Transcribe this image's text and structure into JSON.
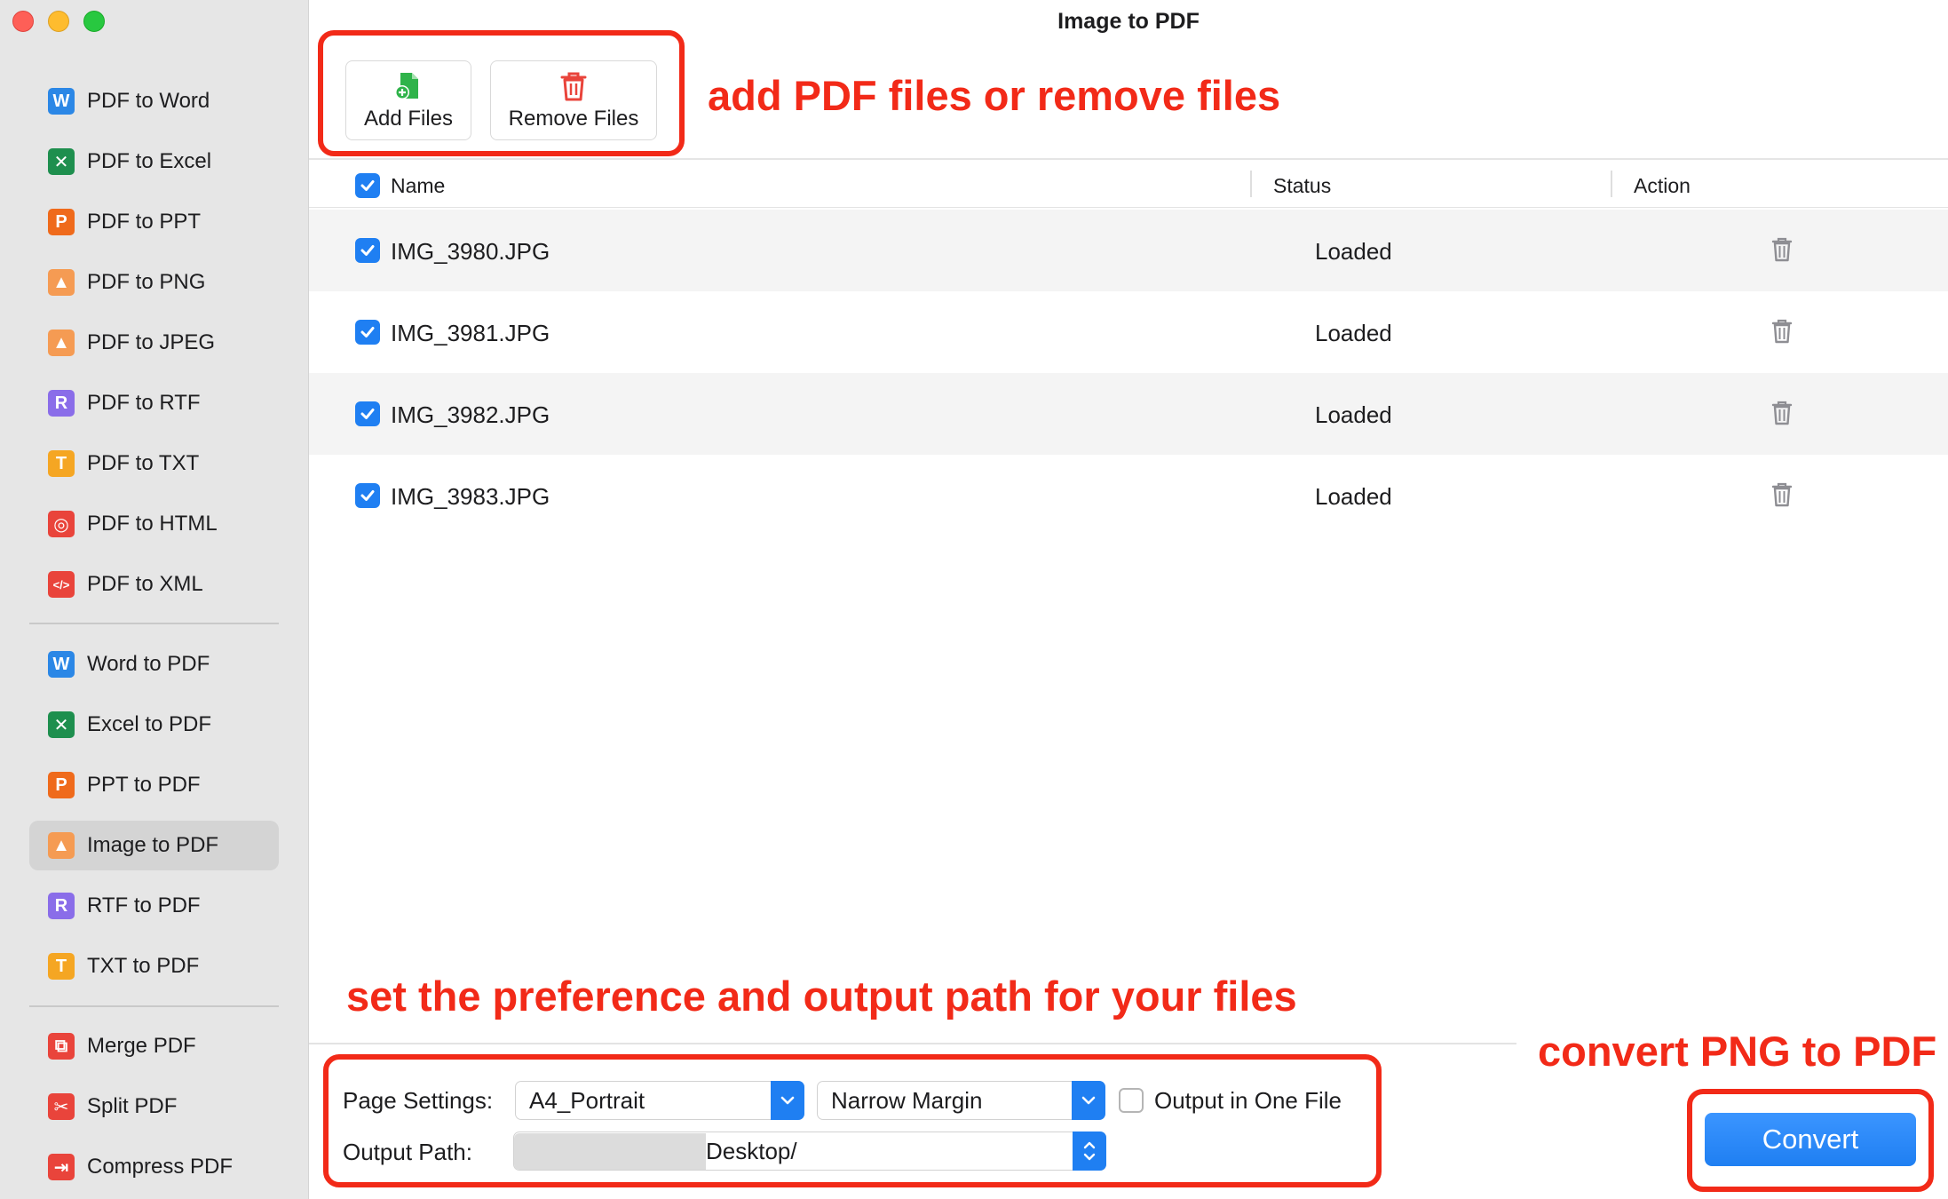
{
  "window": {
    "title": "Image to PDF"
  },
  "sidebar": {
    "items": [
      {
        "label": "PDF to Word",
        "icon": "word-icon",
        "glyph": "W",
        "color": "#2b87e6"
      },
      {
        "label": "PDF to Excel",
        "icon": "excel-icon",
        "glyph": "✕",
        "color": "#1e8f4e"
      },
      {
        "label": "PDF to PPT",
        "icon": "ppt-icon",
        "glyph": "P",
        "color": "#ef6a1b"
      },
      {
        "label": "PDF to PNG",
        "icon": "image-icon",
        "glyph": "▲",
        "color": "#f59b53"
      },
      {
        "label": "PDF to JPEG",
        "icon": "image-icon",
        "glyph": "▲",
        "color": "#f59b53"
      },
      {
        "label": "PDF to RTF",
        "icon": "rtf-icon",
        "glyph": "R",
        "color": "#8a6de9"
      },
      {
        "label": "PDF to TXT",
        "icon": "txt-icon",
        "glyph": "T",
        "color": "#f5a623"
      },
      {
        "label": "PDF to HTML",
        "icon": "globe-icon",
        "glyph": "◎",
        "color": "#e9443b"
      },
      {
        "label": "PDF to XML",
        "icon": "code-icon",
        "glyph": "</>",
        "color": "#e9443b"
      },
      {
        "label": "Word to PDF",
        "icon": "word-icon",
        "glyph": "W",
        "color": "#2b87e6"
      },
      {
        "label": "Excel to PDF",
        "icon": "excel-icon",
        "glyph": "✕",
        "color": "#1e8f4e"
      },
      {
        "label": "PPT to PDF",
        "icon": "ppt-icon",
        "glyph": "P",
        "color": "#ef6a1b"
      },
      {
        "label": "Image to PDF",
        "icon": "image-icon",
        "glyph": "▲",
        "color": "#f59b53"
      },
      {
        "label": "RTF to PDF",
        "icon": "rtf-icon",
        "glyph": "R",
        "color": "#8a6de9"
      },
      {
        "label": "TXT to PDF",
        "icon": "txt-icon",
        "glyph": "T",
        "color": "#f5a623"
      },
      {
        "label": "Merge PDF",
        "icon": "merge-icon",
        "glyph": "⧉",
        "color": "#e9443b"
      },
      {
        "label": "Split PDF",
        "icon": "scissors-icon",
        "glyph": "✂",
        "color": "#e9443b"
      },
      {
        "label": "Compress PDF",
        "icon": "compress-icon",
        "glyph": "⇥",
        "color": "#e9443b"
      }
    ],
    "active": "Image to PDF"
  },
  "toolbar": {
    "add_label": "Add Files",
    "remove_label": "Remove Files"
  },
  "annotations": {
    "top": "add PDF files or remove files",
    "bottom": "set the preference and output path for your files",
    "convert": "convert PNG to PDF"
  },
  "table": {
    "headers": {
      "name": "Name",
      "status": "Status",
      "action": "Action"
    },
    "rows": [
      {
        "name": "IMG_3980.JPG",
        "status": "Loaded"
      },
      {
        "name": "IMG_3981.JPG",
        "status": "Loaded"
      },
      {
        "name": "IMG_3982.JPG",
        "status": "Loaded"
      },
      {
        "name": "IMG_3983.JPG",
        "status": "Loaded"
      }
    ]
  },
  "settings": {
    "page_label": "Page Settings:",
    "page_size": "A4_Portrait",
    "margin": "Narrow Margin",
    "one_file_label": "Output in One File",
    "output_label": "Output Path:",
    "output_path": "Desktop/"
  },
  "convert_label": "Convert",
  "colors": {
    "accent": "#1f7ff2",
    "annotation": "#f22a18"
  }
}
